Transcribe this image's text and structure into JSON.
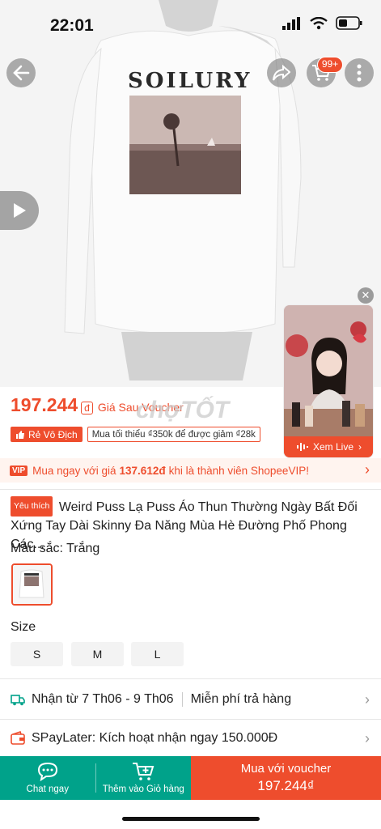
{
  "status_bar": {
    "time": "22:01"
  },
  "header": {
    "cart_badge": "99+"
  },
  "live": {
    "label": "Xem Live"
  },
  "price": {
    "amount": "197.244",
    "currency_icon": "đ",
    "after_voucher": "Giá Sau Voucher",
    "watermark": "chợTỐT"
  },
  "tags": {
    "cheapest": "Rẻ Vô Địch",
    "min_order": "Mua tối thiểu ₫350k để được giảm ₫28k"
  },
  "vip": {
    "badge": "VIP",
    "prefix": "Mua ngay với giá",
    "price": "137.612đ",
    "suffix": "khi là thành viên ShopeeVIP!"
  },
  "product": {
    "favorite_badge": "Yêu thích",
    "title": "Weird Puss Lạ Puss Áo Thun Thường Ngày Bất Đối Xứng Tay Dài Skinny Đa Năng Mùa Hè Đường Phố Phong Các..."
  },
  "color": {
    "label": "Màu sắc:",
    "selected": "Trắng"
  },
  "size": {
    "label": "Size",
    "options": [
      "S",
      "M",
      "L"
    ]
  },
  "shipping": {
    "delivery": "Nhận từ 7 Th06 - 9 Th06",
    "returns": "Miễn phí trả hàng"
  },
  "spaylater": {
    "text": "SPayLater: Kích hoạt nhận ngay 150.000Đ"
  },
  "bottom_bar": {
    "chat": "Chat ngay",
    "add_cart": "Thêm vào Giỏ hàng",
    "buy_line1": "Mua với voucher",
    "buy_line2": "197.244₫"
  },
  "colors": {
    "accent": "#ee4d2d",
    "teal": "#00a28a"
  }
}
